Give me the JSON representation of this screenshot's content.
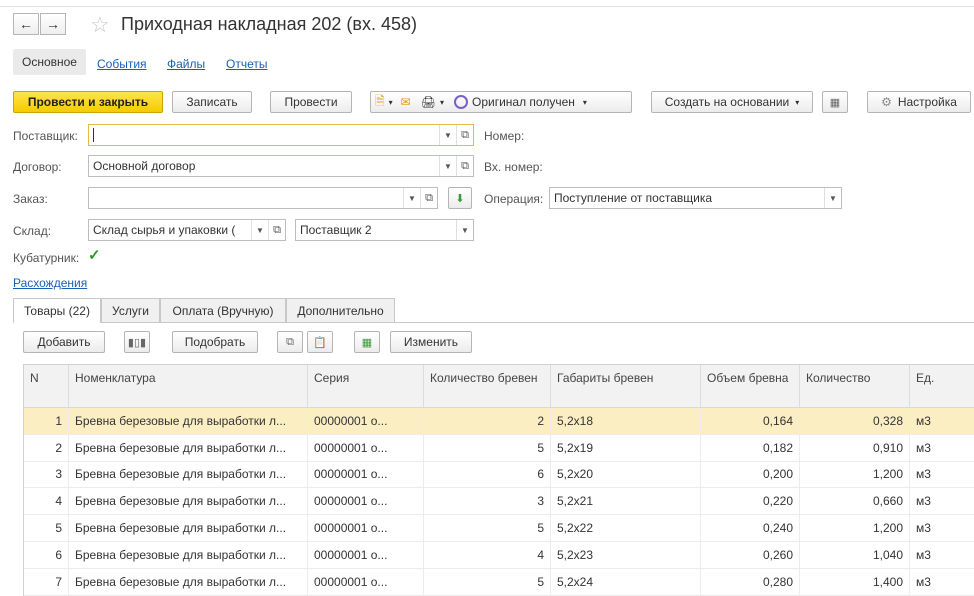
{
  "window": {
    "title": "Приходная накладная 202 (вх. 458)"
  },
  "nav_tabs": [
    {
      "label": "Основное"
    },
    {
      "label": "События"
    },
    {
      "label": "Файлы"
    },
    {
      "label": "Отчеты"
    }
  ],
  "toolbar": {
    "post_close": "Провести и закрыть",
    "save": "Записать",
    "post": "Провести",
    "original": "Оригинал получен",
    "create_based": "Создать на основании",
    "settings": "Настройка"
  },
  "form": {
    "supplier_label": "Поставщик:",
    "supplier_value": "",
    "contract_label": "Договор:",
    "contract_value": "Основной договор",
    "order_label": "Заказ:",
    "order_value": "",
    "warehouse_label": "Склад:",
    "warehouse_value": "Склад сырья и упаковки (",
    "supplier2_value": "Поставщик 2",
    "cubature_label": "Кубатурник:",
    "number_label": "Номер:",
    "in_number_label": "Вх. номер:",
    "operation_label": "Операция:",
    "operation_value": "Поступление от поставщика",
    "discrepancies_link": "Расхождения"
  },
  "section_tabs": [
    {
      "label": "Товары (22)"
    },
    {
      "label": "Услуги"
    },
    {
      "label": "Оплата (Вручную)"
    },
    {
      "label": "Дополнительно"
    }
  ],
  "table_toolbar": {
    "add": "Добавить",
    "pick": "Подобрать",
    "change": "Изменить"
  },
  "table": {
    "headers": [
      "N",
      "Номенклатура",
      "Серия",
      "Количество бревен",
      "Габариты бревен",
      "Объем бревна",
      "Количество",
      "Ед."
    ],
    "rows": [
      [
        "1",
        "Бревна березовые для выработки л...",
        "00000001 о...",
        "2",
        "5,2х18",
        "0,164",
        "0,328",
        "м3"
      ],
      [
        "2",
        "Бревна березовые для выработки л...",
        "00000001 о...",
        "5",
        "5,2х19",
        "0,182",
        "0,910",
        "м3"
      ],
      [
        "3",
        "Бревна березовые для выработки л...",
        "00000001 о...",
        "6",
        "5,2х20",
        "0,200",
        "1,200",
        "м3"
      ],
      [
        "4",
        "Бревна березовые для выработки л...",
        "00000001 о...",
        "3",
        "5,2х21",
        "0,220",
        "0,660",
        "м3"
      ],
      [
        "5",
        "Бревна березовые для выработки л...",
        "00000001 о...",
        "5",
        "5,2х22",
        "0,240",
        "1,200",
        "м3"
      ],
      [
        "6",
        "Бревна березовые для выработки л...",
        "00000001 о...",
        "4",
        "5,2х23",
        "0,260",
        "1,040",
        "м3"
      ],
      [
        "7",
        "Бревна березовые для выработки л...",
        "00000001 о...",
        "5",
        "5,2х24",
        "0,280",
        "1,400",
        "м3"
      ]
    ]
  },
  "colors": {
    "accent_yellow": "#f5cc00",
    "link": "#1a5fb4",
    "selected_row": "#fbeec3"
  }
}
